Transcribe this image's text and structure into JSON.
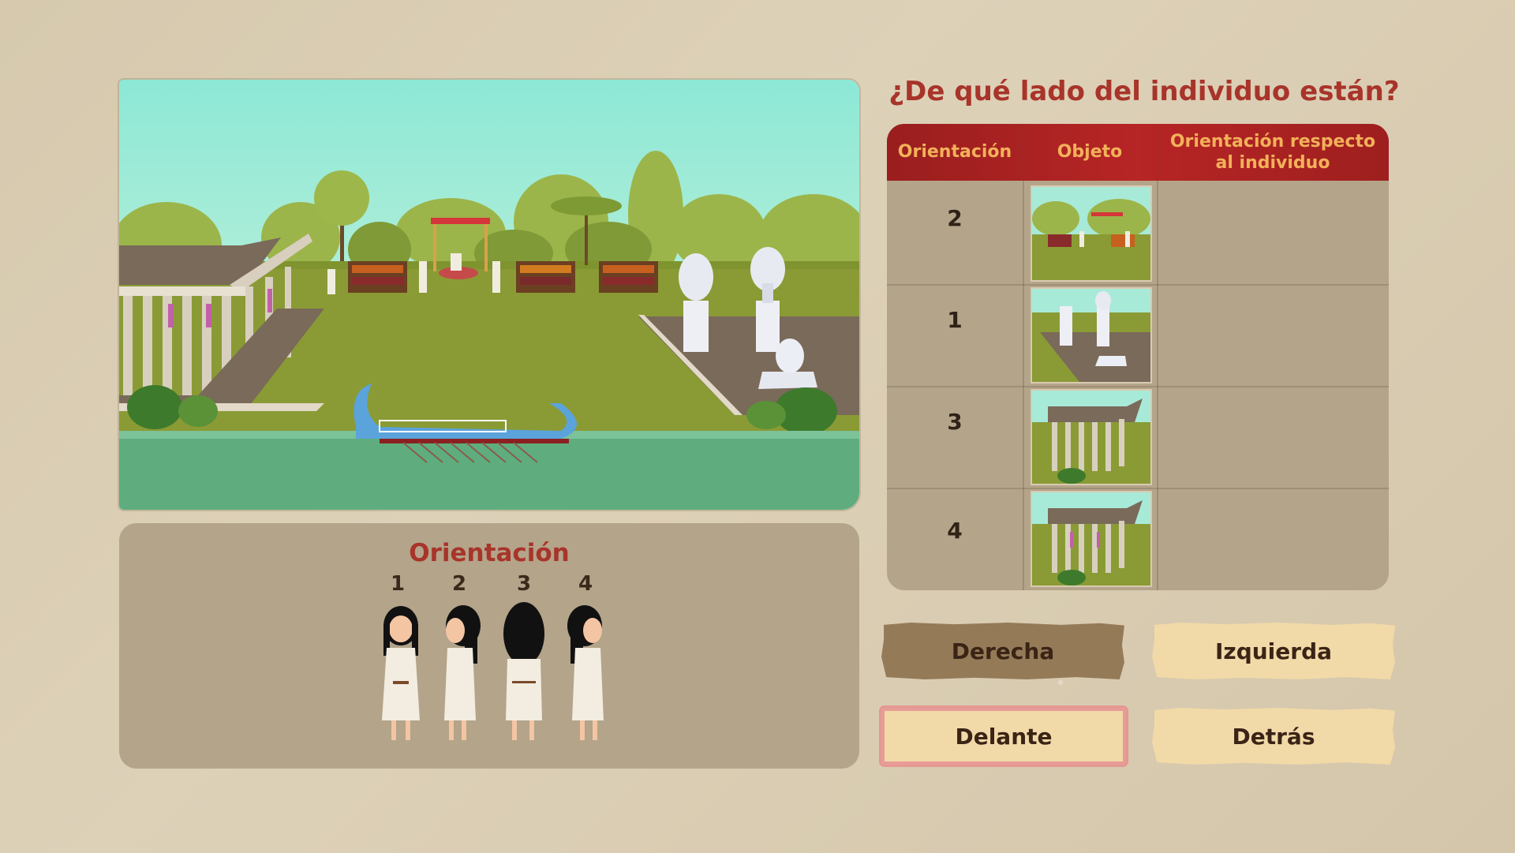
{
  "question": "¿De qué lado del individuo están?",
  "table": {
    "headers": [
      "Orientación",
      "Objeto",
      "Orientación respecto al individuo"
    ],
    "rows": [
      {
        "orientation": "2",
        "object": "market-stalls",
        "answer": ""
      },
      {
        "orientation": "1",
        "object": "statues",
        "answer": ""
      },
      {
        "orientation": "3",
        "object": "temple",
        "answer": ""
      },
      {
        "orientation": "4",
        "object": "temple",
        "answer": ""
      }
    ]
  },
  "orientation_panel": {
    "title": "Orientación",
    "figures": [
      "1",
      "2",
      "3",
      "4"
    ]
  },
  "answers": {
    "right": "Derecha",
    "left": "Izquierda",
    "front": "Delante",
    "behind": "Detrás"
  },
  "colors": {
    "title_red": "#a8342a",
    "header_red": "#b72525",
    "header_text": "#f3b15a",
    "panel": "#b3a48a",
    "button_light": "#f2d9a8",
    "button_dark": "#957a58",
    "selected_border": "#e59893"
  }
}
